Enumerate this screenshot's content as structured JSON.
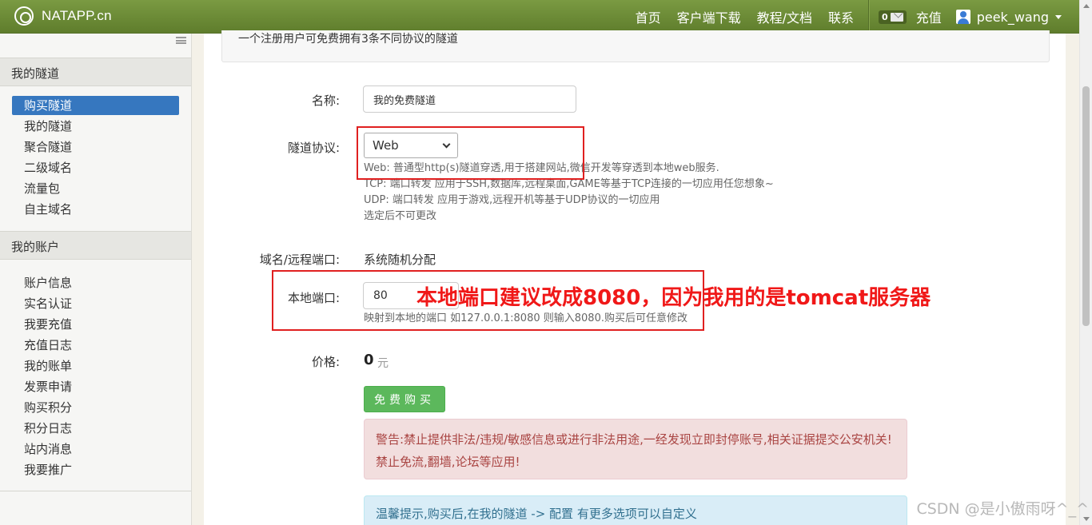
{
  "navbar": {
    "brand": "NATAPP.cn",
    "links": [
      "首页",
      "客户端下载",
      "教程/文档",
      "联系"
    ],
    "message_count": "0",
    "recharge": "充值",
    "username": "peek_wang"
  },
  "sidebar": {
    "section_tunnels": "我的隧道",
    "tunnel_items": [
      "购买隧道",
      "我的隧道",
      "聚合隧道",
      "二级域名",
      "流量包",
      "自主域名"
    ],
    "section_account": "我的账户",
    "account_items": [
      "账户信息",
      "实名认证",
      "我要充值",
      "充值日志",
      "我的账单",
      "发票申请",
      "购买积分",
      "积分日志",
      "站内消息",
      "我要推广"
    ]
  },
  "main": {
    "info_text": "一个注册用户可免费拥有3条不同协议的隧道",
    "name_label": "名称:",
    "name_value": "我的免费隧道",
    "protocol_label": "隧道协议:",
    "protocol_selected": "Web",
    "protocol_help": [
      "Web: 普通型http(s)隧道穿透,用于搭建网站,微信开发等穿透到本地web服务.",
      "TCP: 端口转发 应用于SSH,数据库,远程桌面,GAME等基于TCP连接的一切应用任您想象~",
      "UDP: 端口转发 应用于游戏,远程开机等基于UDP协议的一切应用",
      "选定后不可更改"
    ],
    "domain_label": "域名/远程端口:",
    "domain_value": "系统随机分配",
    "port_label": "本地端口:",
    "port_value": "80",
    "port_help": "映射到本地的端口 如127.0.0.1:8080 则输入8080.购买后可任意修改",
    "annotation": "本地端口建议改成8080，因为我用的是tomcat服务器",
    "price_label": "价格:",
    "price_value": "0",
    "price_unit": "元",
    "buy_button": "免费购买",
    "warning": "警告:禁止提供非法/违规/敏感信息或进行非法用途,一经发现立即封停账号,相关证据提交公安机关!禁止免流,翻墙,论坛等应用!",
    "tip": "温馨提示,购买后,在我的隧道 -> 配置 有更多选项可以自定义"
  },
  "watermark": "CSDN @是小傲雨呀^_^",
  "colors": {
    "navbar": "#6c8a36",
    "active_item": "#3677bf",
    "buy_button": "#5cb85c",
    "annotation": "#f01818"
  }
}
